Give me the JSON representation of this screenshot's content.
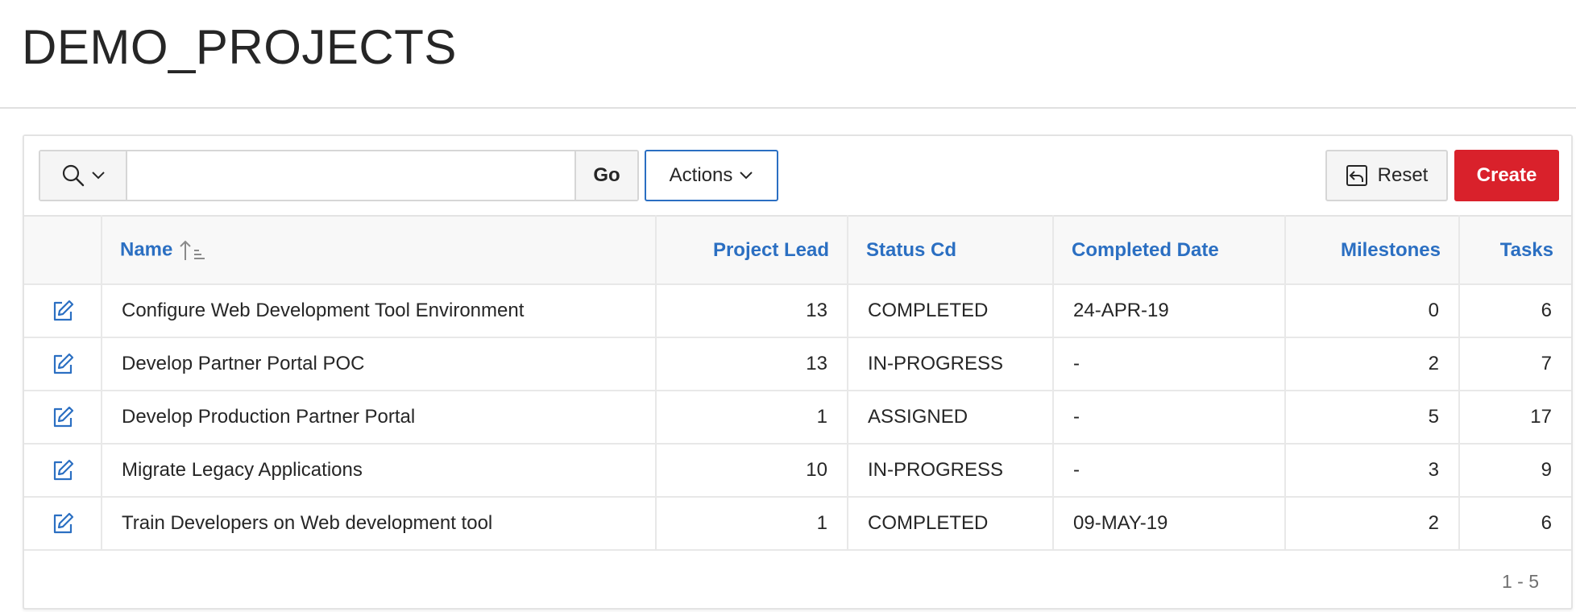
{
  "page": {
    "title": "DEMO_PROJECTS"
  },
  "toolbar": {
    "search_icon": "search-icon",
    "search_placeholder": "",
    "search_value": "",
    "go_label": "Go",
    "actions_label": "Actions",
    "reset_label": "Reset",
    "create_label": "Create"
  },
  "colors": {
    "link_blue": "#2b6fc2",
    "create_red": "#d9212b"
  },
  "table": {
    "columns": {
      "name": "Name",
      "project_lead": "Project Lead",
      "status_cd": "Status Cd",
      "completed_date": "Completed Date",
      "milestones": "Milestones",
      "tasks": "Tasks"
    },
    "sort": {
      "column": "Name",
      "direction": "ascending"
    },
    "rows": [
      {
        "name": "Configure Web Development Tool Environment",
        "project_lead": "13",
        "status_cd": "COMPLETED",
        "completed_date": "24-APR-19",
        "milestones": "0",
        "tasks": "6"
      },
      {
        "name": "Develop Partner Portal POC",
        "project_lead": "13",
        "status_cd": "IN-PROGRESS",
        "completed_date": "-",
        "milestones": "2",
        "tasks": "7"
      },
      {
        "name": "Develop Production Partner Portal",
        "project_lead": "1",
        "status_cd": "ASSIGNED",
        "completed_date": "-",
        "milestones": "5",
        "tasks": "17"
      },
      {
        "name": "Migrate Legacy Applications",
        "project_lead": "10",
        "status_cd": "IN-PROGRESS",
        "completed_date": "-",
        "milestones": "3",
        "tasks": "9"
      },
      {
        "name": "Train Developers on Web development tool",
        "project_lead": "1",
        "status_cd": "COMPLETED",
        "completed_date": "09-MAY-19",
        "milestones": "2",
        "tasks": "6"
      }
    ]
  },
  "pagination": {
    "label": "1 - 5"
  }
}
